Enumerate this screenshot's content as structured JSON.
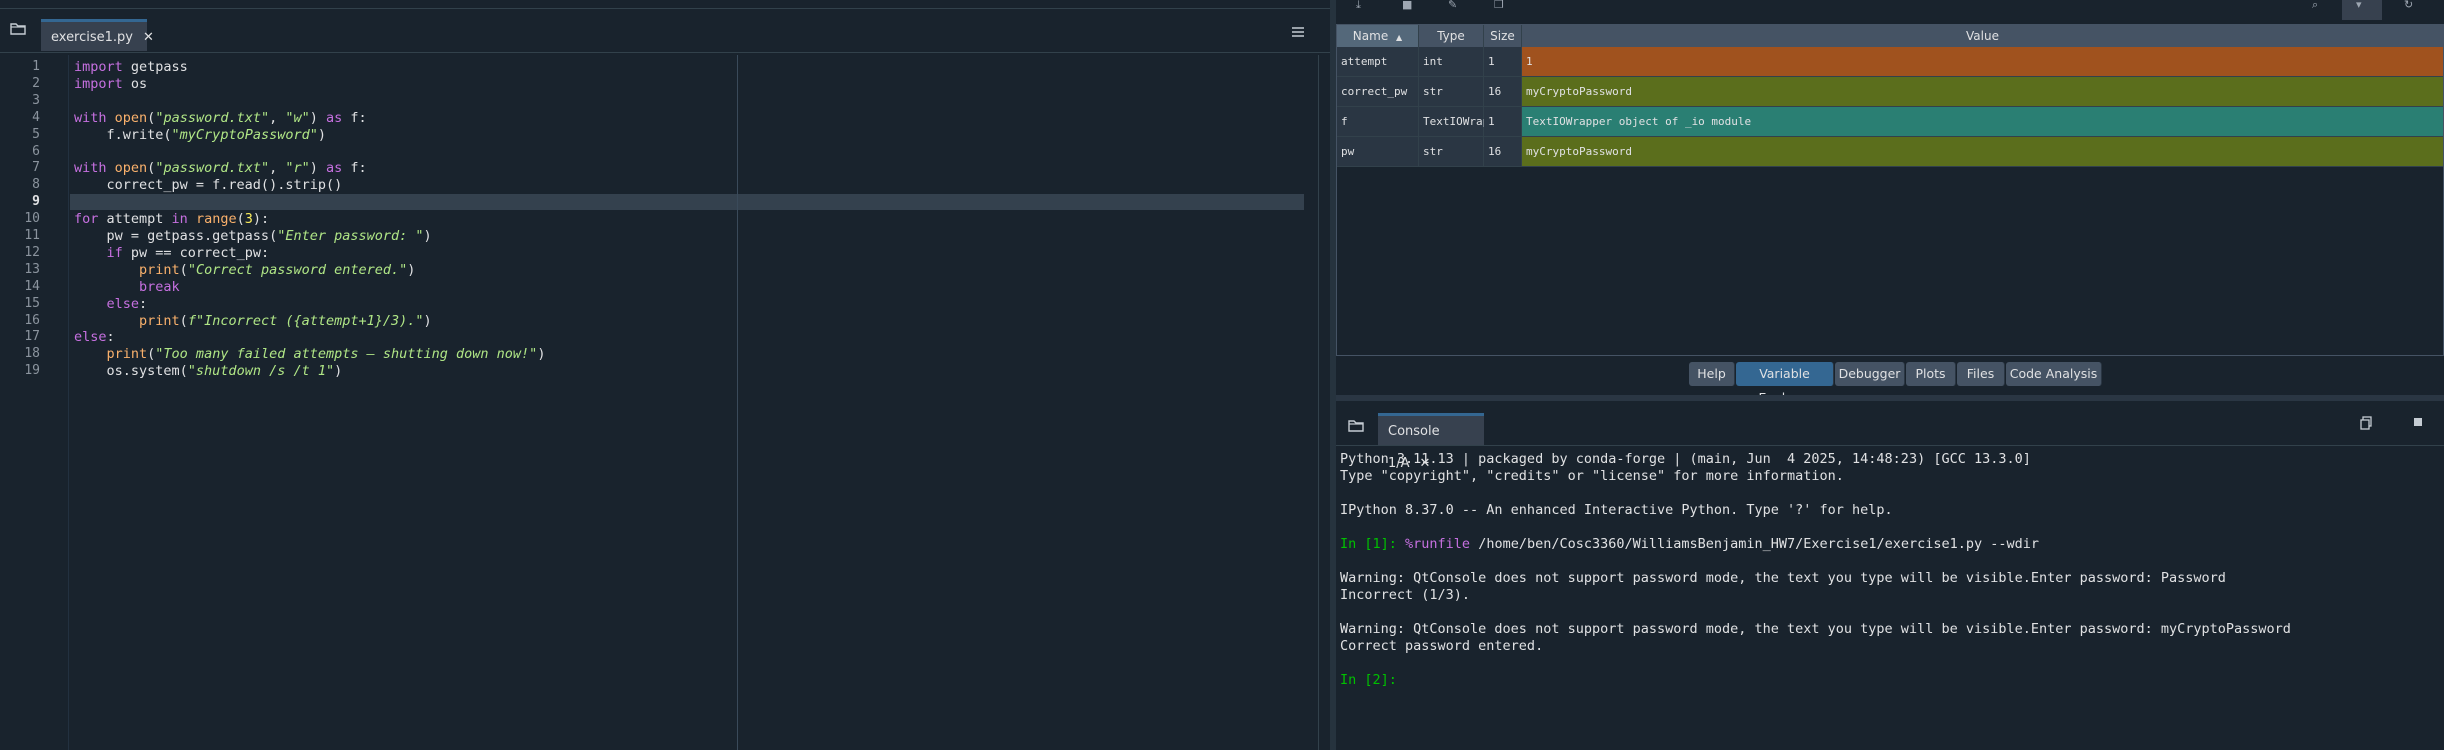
{
  "editor": {
    "tab": {
      "label": "exercise1.py",
      "close": "✕"
    },
    "menu_icon": "hamburger-menu-icon",
    "browse_icon": "folder-icon",
    "current_line": 9,
    "lines": [
      {
        "n": "1",
        "tokens": [
          {
            "c": "kw",
            "t": "import"
          },
          {
            "c": "",
            "t": " getpass"
          }
        ]
      },
      {
        "n": "2",
        "tokens": [
          {
            "c": "kw",
            "t": "import"
          },
          {
            "c": "",
            "t": " os"
          }
        ]
      },
      {
        "n": "3",
        "tokens": []
      },
      {
        "n": "4",
        "tokens": [
          {
            "c": "kw",
            "t": "with"
          },
          {
            "c": "",
            "t": " "
          },
          {
            "c": "bi",
            "t": "open"
          },
          {
            "c": "",
            "t": "("
          },
          {
            "c": "st",
            "t": "\"password.txt\""
          },
          {
            "c": "",
            "t": ", "
          },
          {
            "c": "st",
            "t": "\"w\""
          },
          {
            "c": "",
            "t": ") "
          },
          {
            "c": "kw",
            "t": "as"
          },
          {
            "c": "",
            "t": " f:"
          }
        ]
      },
      {
        "n": "5",
        "tokens": [
          {
            "c": "",
            "t": "    f.write("
          },
          {
            "c": "st",
            "t": "\"myCryptoPassword\""
          },
          {
            "c": "",
            "t": ")"
          }
        ]
      },
      {
        "n": "6",
        "tokens": []
      },
      {
        "n": "7",
        "tokens": [
          {
            "c": "kw",
            "t": "with"
          },
          {
            "c": "",
            "t": " "
          },
          {
            "c": "bi",
            "t": "open"
          },
          {
            "c": "",
            "t": "("
          },
          {
            "c": "st",
            "t": "\"password.txt\""
          },
          {
            "c": "",
            "t": ", "
          },
          {
            "c": "st",
            "t": "\"r\""
          },
          {
            "c": "",
            "t": ") "
          },
          {
            "c": "kw",
            "t": "as"
          },
          {
            "c": "",
            "t": " f:"
          }
        ]
      },
      {
        "n": "8",
        "tokens": [
          {
            "c": "",
            "t": "    correct_pw = f.read().strip()"
          }
        ]
      },
      {
        "n": "9",
        "tokens": []
      },
      {
        "n": "10",
        "tokens": [
          {
            "c": "kw",
            "t": "for"
          },
          {
            "c": "",
            "t": " attempt "
          },
          {
            "c": "kw",
            "t": "in"
          },
          {
            "c": "",
            "t": " "
          },
          {
            "c": "bi",
            "t": "range"
          },
          {
            "c": "",
            "t": "("
          },
          {
            "c": "nm",
            "t": "3"
          },
          {
            "c": "",
            "t": "):"
          }
        ]
      },
      {
        "n": "11",
        "tokens": [
          {
            "c": "",
            "t": "    pw = getpass.getpass("
          },
          {
            "c": "st",
            "t": "\"Enter password: \""
          },
          {
            "c": "",
            "t": ")"
          }
        ]
      },
      {
        "n": "12",
        "tokens": [
          {
            "c": "",
            "t": "    "
          },
          {
            "c": "kw",
            "t": "if"
          },
          {
            "c": "",
            "t": " pw == correct_pw:"
          }
        ]
      },
      {
        "n": "13",
        "tokens": [
          {
            "c": "",
            "t": "        "
          },
          {
            "c": "bi",
            "t": "print"
          },
          {
            "c": "",
            "t": "("
          },
          {
            "c": "st",
            "t": "\"Correct password entered.\""
          },
          {
            "c": "",
            "t": ")"
          }
        ]
      },
      {
        "n": "14",
        "tokens": [
          {
            "c": "",
            "t": "        "
          },
          {
            "c": "kw",
            "t": "break"
          }
        ]
      },
      {
        "n": "15",
        "tokens": [
          {
            "c": "",
            "t": "    "
          },
          {
            "c": "kw",
            "t": "else"
          },
          {
            "c": "",
            "t": ":"
          }
        ]
      },
      {
        "n": "16",
        "tokens": [
          {
            "c": "",
            "t": "        "
          },
          {
            "c": "bi",
            "t": "print"
          },
          {
            "c": "",
            "t": "("
          },
          {
            "c": "st",
            "t": "f\"Incorrect ({attempt+1}/3).\""
          },
          {
            "c": "",
            "t": ")"
          }
        ]
      },
      {
        "n": "17",
        "tokens": [
          {
            "c": "kw",
            "t": "else"
          },
          {
            "c": "",
            "t": ":"
          }
        ]
      },
      {
        "n": "18",
        "tokens": [
          {
            "c": "",
            "t": "    "
          },
          {
            "c": "bi",
            "t": "print"
          },
          {
            "c": "",
            "t": "("
          },
          {
            "c": "st",
            "t": "\"Too many failed attempts — shutting down now!\""
          },
          {
            "c": "",
            "t": ")"
          }
        ]
      },
      {
        "n": "19",
        "tokens": [
          {
            "c": "",
            "t": "    os.system("
          },
          {
            "c": "st",
            "t": "\"shutdown /s /t 1\""
          },
          {
            "c": "",
            "t": ")"
          }
        ]
      }
    ]
  },
  "variable_explorer": {
    "toolbar_icons": [
      "import-data-icon",
      "save-data-icon",
      "save-as-icon",
      "copy-icon",
      "search-icon",
      "filter-icon",
      "refresh-icon"
    ],
    "columns": {
      "name": "Name",
      "sort_indicator": "▲",
      "type": "Type",
      "size": "Size",
      "value": "Value"
    },
    "rows": [
      {
        "name": "attempt",
        "type": "int",
        "size": "1",
        "value": "1",
        "color": "#a0521e"
      },
      {
        "name": "correct_pw",
        "type": "str",
        "size": "16",
        "value": "myCryptoPassword",
        "color": "#5b6e1c"
      },
      {
        "name": "f",
        "type": "TextIOWrapper",
        "size": "1",
        "value": "TextIOWrapper object of _io module",
        "color": "#2a7f73"
      },
      {
        "name": "pw",
        "type": "str",
        "size": "16",
        "value": "myCryptoPassword",
        "color": "#5b6e1c"
      }
    ]
  },
  "pane_tabs": [
    {
      "label": "Help",
      "active": false
    },
    {
      "label": "Variable Explorer",
      "active": true
    },
    {
      "label": "Debugger",
      "active": false
    },
    {
      "label": "Plots",
      "active": false
    },
    {
      "label": "Files",
      "active": false
    },
    {
      "label": "Code Analysis",
      "active": false
    }
  ],
  "console": {
    "tab": {
      "label": "Console 1/A",
      "close": "✕"
    },
    "browse_icon": "folder-icon",
    "copy_icon": "copy-icon",
    "stop_icon": "stop-icon",
    "lines": [
      {
        "segs": [
          {
            "c": "",
            "t": "Python 3.11.13 | packaged by conda-forge | (main, Jun  4 2025, 14:48:23) [GCC 13.3.0]"
          }
        ]
      },
      {
        "segs": [
          {
            "c": "",
            "t": "Type \"copyright\", \"credits\" or \"license\" for more information."
          }
        ]
      },
      {
        "segs": []
      },
      {
        "segs": [
          {
            "c": "",
            "t": "IPython 8.37.0 -- An enhanced Interactive Python. Type '?' for help."
          }
        ]
      },
      {
        "segs": []
      },
      {
        "segs": [
          {
            "c": "prompt",
            "t": "In [1]: "
          },
          {
            "c": "magic",
            "t": "%runfile"
          },
          {
            "c": "",
            "t": " /home/ben/Cosc3360/WilliamsBenjamin_HW7/Exercise1/exercise1.py --wdir"
          }
        ]
      },
      {
        "segs": []
      },
      {
        "segs": [
          {
            "c": "",
            "t": "Warning: QtConsole does not support password mode, the text you type will be visible.Enter password: Password"
          }
        ]
      },
      {
        "segs": [
          {
            "c": "",
            "t": "Incorrect (1/3)."
          }
        ]
      },
      {
        "segs": []
      },
      {
        "segs": [
          {
            "c": "",
            "t": "Warning: QtConsole does not support password mode, the text you type will be visible.Enter password: myCryptoPassword"
          }
        ]
      },
      {
        "segs": [
          {
            "c": "",
            "t": "Correct password entered."
          }
        ]
      },
      {
        "segs": []
      },
      {
        "segs": [
          {
            "c": "prompt",
            "t": "In [2]: "
          }
        ]
      }
    ]
  }
}
